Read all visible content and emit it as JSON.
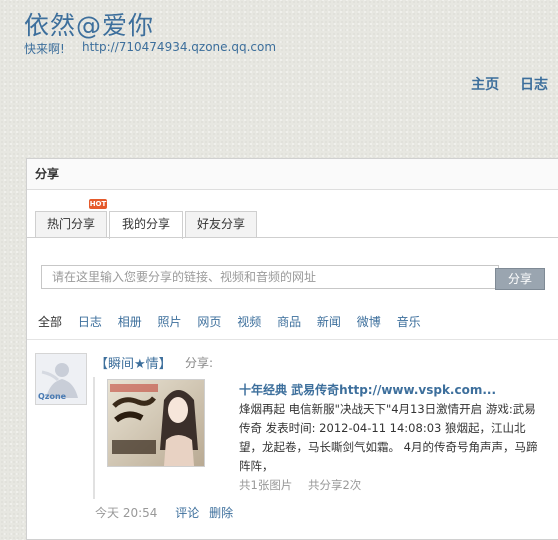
{
  "header": {
    "title": "依然@爱你",
    "tagline": "快来啊!",
    "url": "http://710474934.qzone.qq.com"
  },
  "topnav": {
    "home": "主页",
    "blog": "日志"
  },
  "panel": {
    "title": "分享",
    "tabs": [
      {
        "label": "热门分享",
        "badge": "HOT"
      },
      {
        "label": "我的分享"
      },
      {
        "label": "好友分享"
      }
    ],
    "active_tab": "我的分享",
    "share_input_placeholder": "请在这里输入您要分享的链接、视频和音频的网址",
    "share_button": "分享",
    "filters": [
      "全部",
      "日志",
      "相册",
      "照片",
      "网页",
      "视频",
      "商品",
      "新闻",
      "微博",
      "音乐"
    ]
  },
  "feed": {
    "user": "【瞬间★情】",
    "action": "分享:",
    "avatar_label": "Qzone",
    "card": {
      "title": "十年经典 武易传奇http://www.vspk.com...",
      "description": "烽烟再起 电信新服\"决战天下\"4月13日激情开启 游戏:武易传奇 发表时间: 2012-04-11 14:08:03 狼烟起，江山北望，龙起卷，马长嘶剑气如霜。 4月的传奇号角声声，马蹄阵阵，",
      "image_count": "共1张图片",
      "share_count": "共分享2次"
    },
    "time": "今天 20:54",
    "comment": "评论",
    "delete": "删除"
  },
  "colors": {
    "link": "#3d6f9c",
    "hot_badge": "#e55a2b",
    "background": "#e7e7e1"
  }
}
